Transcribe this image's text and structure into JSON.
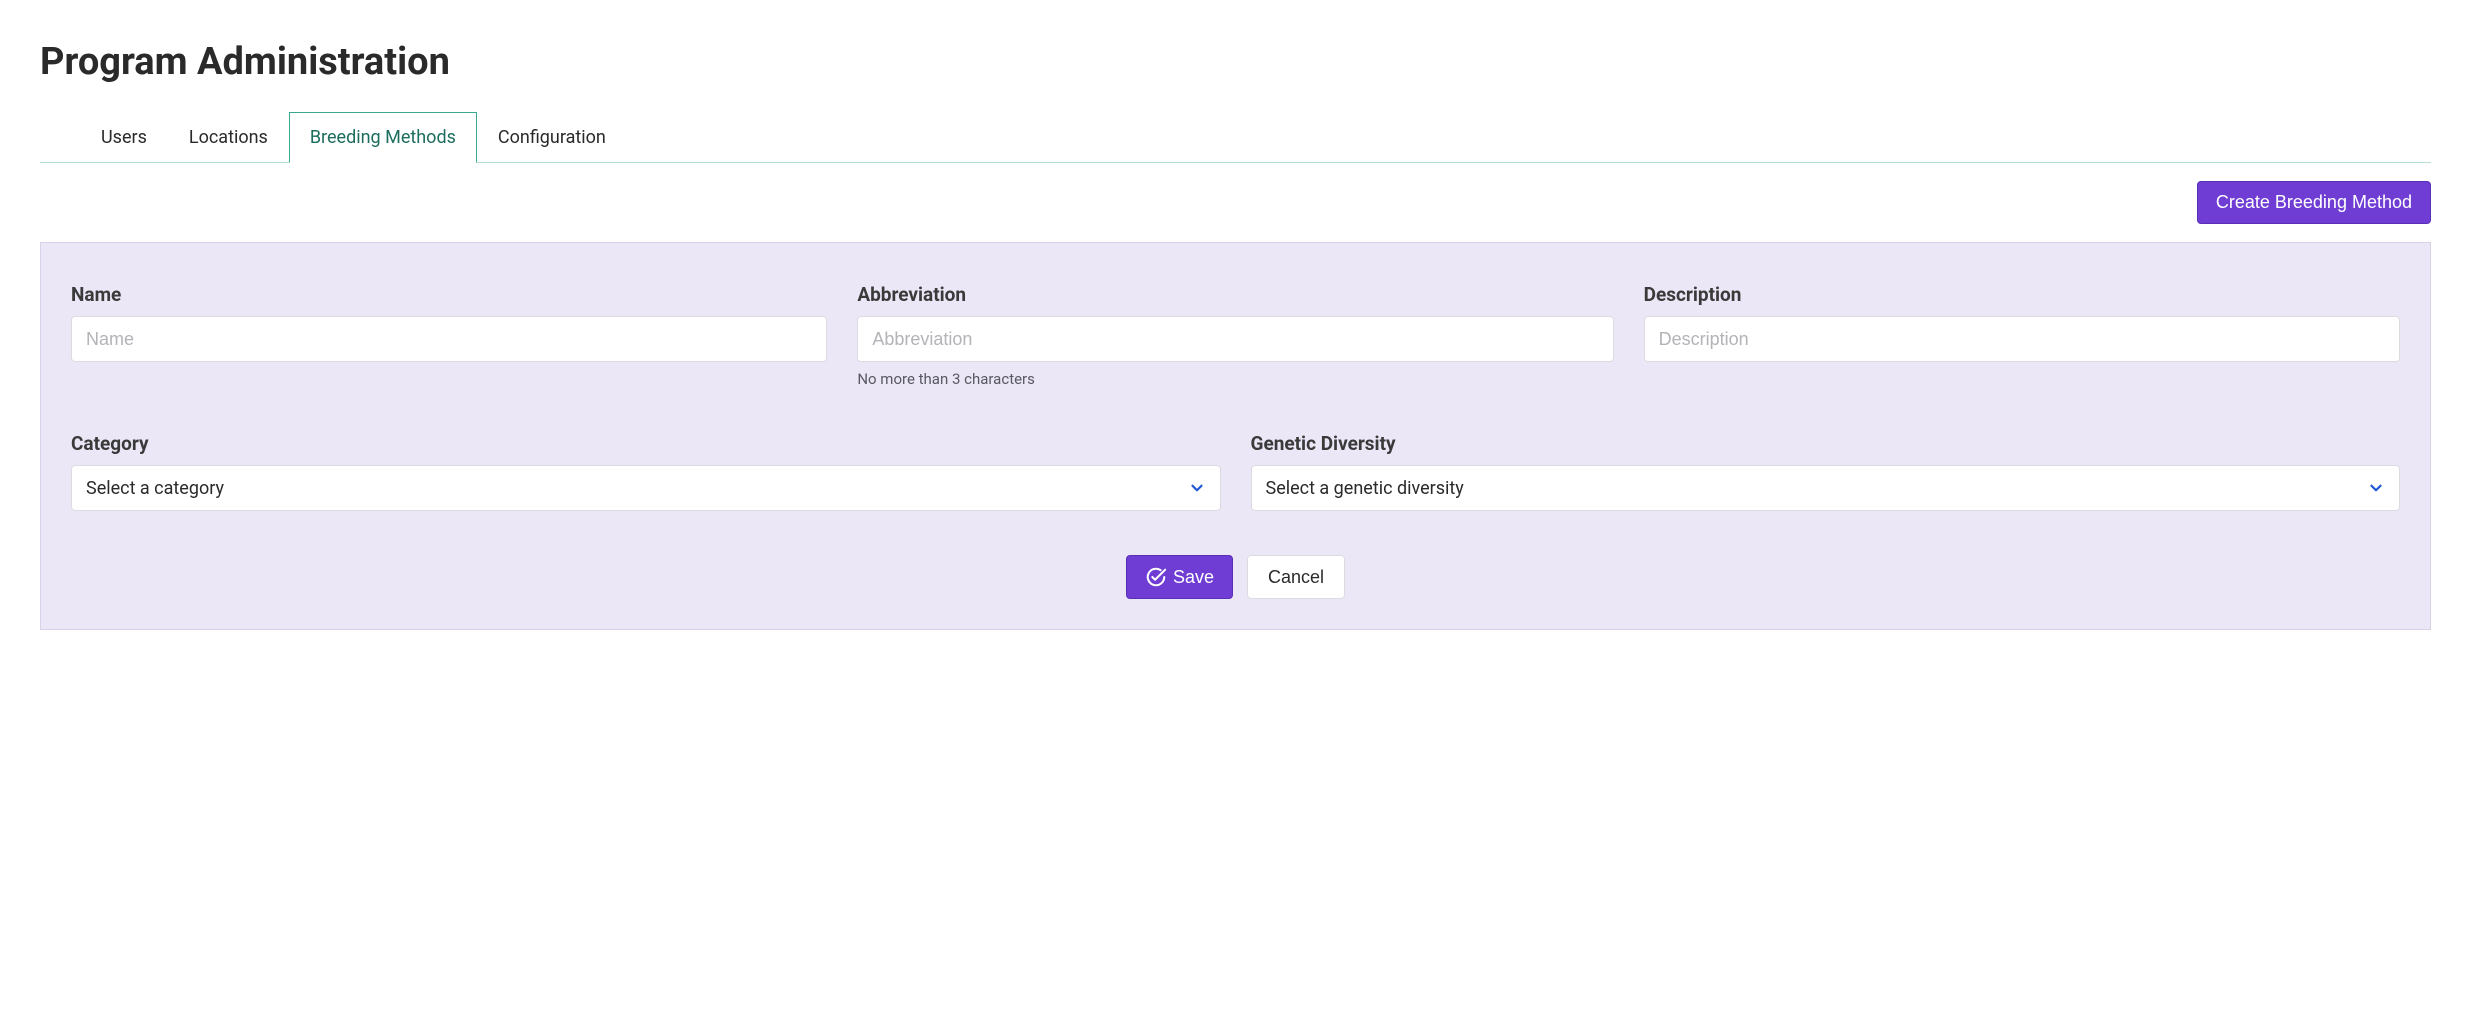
{
  "header": {
    "title": "Program Administration"
  },
  "tabs": {
    "users": "Users",
    "locations": "Locations",
    "breeding_methods": "Breeding Methods",
    "configuration": "Configuration"
  },
  "actions": {
    "create_breeding_method": "Create Breeding Method"
  },
  "form": {
    "name": {
      "label": "Name",
      "placeholder": "Name"
    },
    "abbreviation": {
      "label": "Abbreviation",
      "placeholder": "Abbreviation",
      "help": "No more than 3 characters"
    },
    "description": {
      "label": "Description",
      "placeholder": "Description"
    },
    "category": {
      "label": "Category",
      "selected": "Select a category"
    },
    "genetic_diversity": {
      "label": "Genetic Diversity",
      "selected": "Select a genetic diversity"
    },
    "buttons": {
      "save": "Save",
      "cancel": "Cancel"
    }
  }
}
